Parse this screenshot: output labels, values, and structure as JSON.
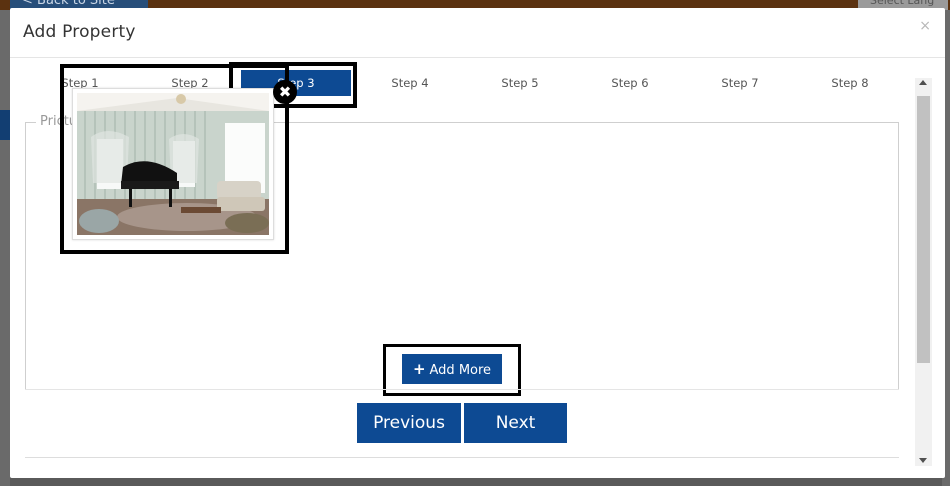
{
  "background": {
    "back_link": "< Back to Site",
    "select_label": "Select Lang"
  },
  "modal": {
    "title": "Add Property",
    "close_glyph": "×"
  },
  "steps": [
    {
      "label": "Step 1",
      "active": false
    },
    {
      "label": "Step 2",
      "active": false
    },
    {
      "label": "Step 3",
      "active": true
    },
    {
      "label": "Step 4",
      "active": false
    },
    {
      "label": "Step 5",
      "active": false
    },
    {
      "label": "Step 6",
      "active": false
    },
    {
      "label": "Step 7",
      "active": false
    },
    {
      "label": "Step 8",
      "active": false
    }
  ],
  "pictures": {
    "legend": "Prictures",
    "remove_glyph": "✖",
    "add_more_label": "Add More",
    "add_more_icon": "plus-icon"
  },
  "nav": {
    "previous_label": "Previous",
    "next_label": "Next"
  },
  "colors": {
    "accent": "#0d4a93",
    "overlay": "#5a5a5a"
  }
}
